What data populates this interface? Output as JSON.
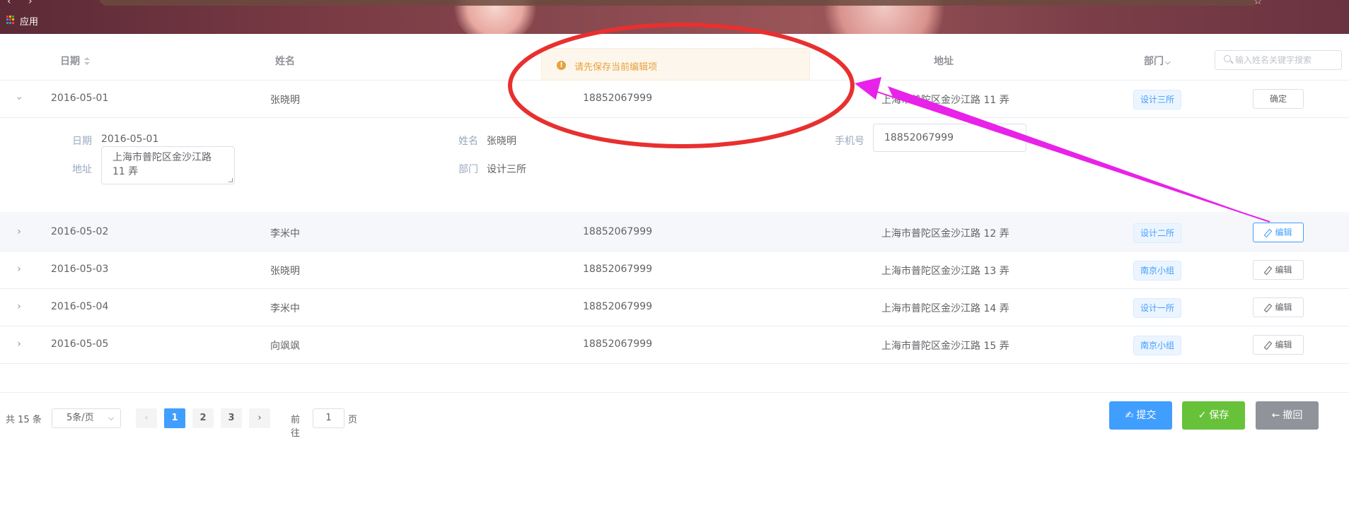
{
  "browser": {
    "apps_label": "应用"
  },
  "table": {
    "headers": {
      "date": "日期",
      "name": "姓名",
      "address": "地址",
      "dept": "部门"
    },
    "search_placeholder": "输入姓名关键字搜索",
    "rows": [
      {
        "date": "2016-05-01",
        "name": "张晓明",
        "phone": "18852067999",
        "address": "上海市普陀区金沙江路 11 弄",
        "dept": "设计三所",
        "action": "确定"
      },
      {
        "date": "2016-05-02",
        "name": "李米中",
        "phone": "18852067999",
        "address": "上海市普陀区金沙江路 12 弄",
        "dept": "设计二所",
        "action": "编辑"
      },
      {
        "date": "2016-05-03",
        "name": "张晓明",
        "phone": "18852067999",
        "address": "上海市普陀区金沙江路 13 弄",
        "dept": "南京小组",
        "action": "编辑"
      },
      {
        "date": "2016-05-04",
        "name": "李米中",
        "phone": "18852067999",
        "address": "上海市普陀区金沙江路 14 弄",
        "dept": "设计一所",
        "action": "编辑"
      },
      {
        "date": "2016-05-05",
        "name": "向飒飒",
        "phone": "18852067999",
        "address": "上海市普陀区金沙江路 15 弄",
        "dept": "南京小组",
        "action": "编辑"
      }
    ],
    "expanded": {
      "date_label": "日期",
      "date_value": "2016-05-01",
      "name_label": "姓名",
      "name_value": "张晓明",
      "phone_label": "手机号",
      "phone_value": "18852067999",
      "address_label": "地址",
      "address_line1": "上海市普陀区金沙江路",
      "address_line2": "11 弄",
      "dept_label": "部门",
      "dept_value": "设计三所"
    }
  },
  "toast": {
    "message": "请先保存当前编辑项",
    "type": "warning"
  },
  "pagination": {
    "total": "共 15 条",
    "page_size": "5条/页",
    "pages": [
      "1",
      "2",
      "3"
    ],
    "current_page": "1",
    "goto_label": "前往",
    "goto_value": "1",
    "goto_suffix": "页"
  },
  "actions": {
    "submit": "提交",
    "save": "保存",
    "revert": "撤回"
  },
  "colors": {
    "primary": "#409eff",
    "success": "#67c23a",
    "info": "#909399",
    "warning": "#e6a23c",
    "annotation_ellipse": "#e8302f",
    "annotation_arrow": "#e822e8"
  }
}
